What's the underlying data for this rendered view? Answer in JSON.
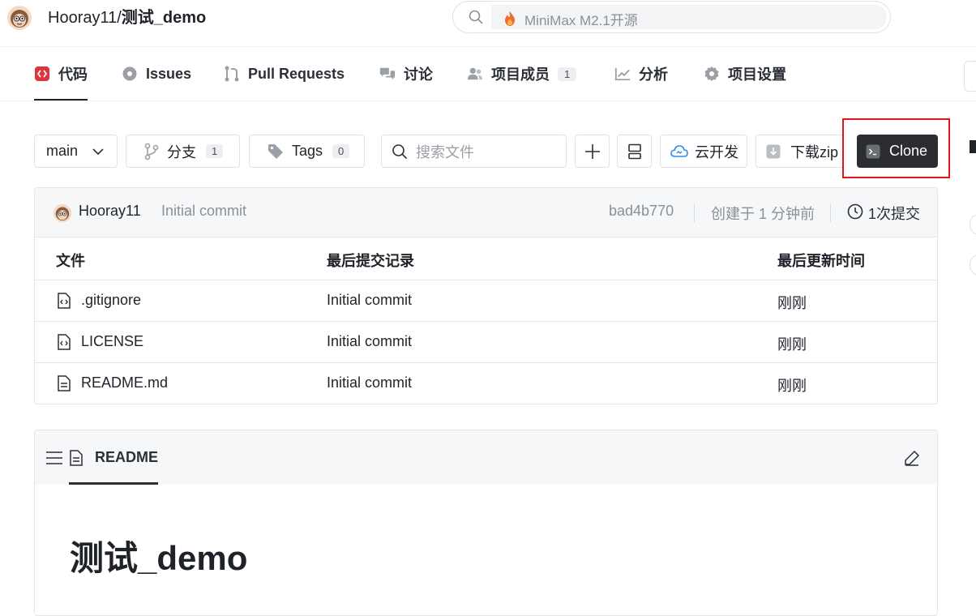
{
  "header": {
    "owner": "Hooray11",
    "separator": "/",
    "repo": "测试_demo",
    "search_placeholder": "MiniMax M2.1开源"
  },
  "tabs": [
    {
      "label": "代码",
      "icon": "code-icon",
      "active": true
    },
    {
      "label": "Issues",
      "icon": "issue-icon"
    },
    {
      "label": "Pull Requests",
      "icon": "pull-request-icon"
    },
    {
      "label": "讨论",
      "icon": "discussion-icon"
    },
    {
      "label": "项目成员",
      "icon": "members-icon",
      "count": "1"
    },
    {
      "label": "分析",
      "icon": "analytics-icon"
    },
    {
      "label": "项目设置",
      "icon": "gear-icon"
    }
  ],
  "toolbar": {
    "branch": "main",
    "branches_label": "分支",
    "branches_count": "1",
    "tags_label": "Tags",
    "tags_count": "0",
    "search_placeholder": "搜索文件",
    "cloud_label": "云开发",
    "download_label": "下载zip",
    "clone_label": "Clone"
  },
  "commit": {
    "author": "Hooray11",
    "message": "Initial commit",
    "hash": "bad4b770",
    "created": "创建于 1 分钟前",
    "commits": "1次提交"
  },
  "files": {
    "headers": [
      "文件",
      "最后提交记录",
      "最后更新时间"
    ],
    "rows": [
      {
        "name": ".gitignore",
        "message": "Initial commit",
        "time": "刚刚",
        "icon": "code-file-icon"
      },
      {
        "name": "LICENSE",
        "message": "Initial commit",
        "time": "刚刚",
        "icon": "code-file-icon"
      },
      {
        "name": "README.md",
        "message": "Initial commit",
        "time": "刚刚",
        "icon": "text-file-icon"
      }
    ]
  },
  "readme": {
    "tab_label": "README",
    "title": "测试_demo"
  },
  "colors": {
    "accent_red": "#e5141b",
    "code_icon_red": "#d9363e",
    "clone_bg": "#2b2d31"
  }
}
